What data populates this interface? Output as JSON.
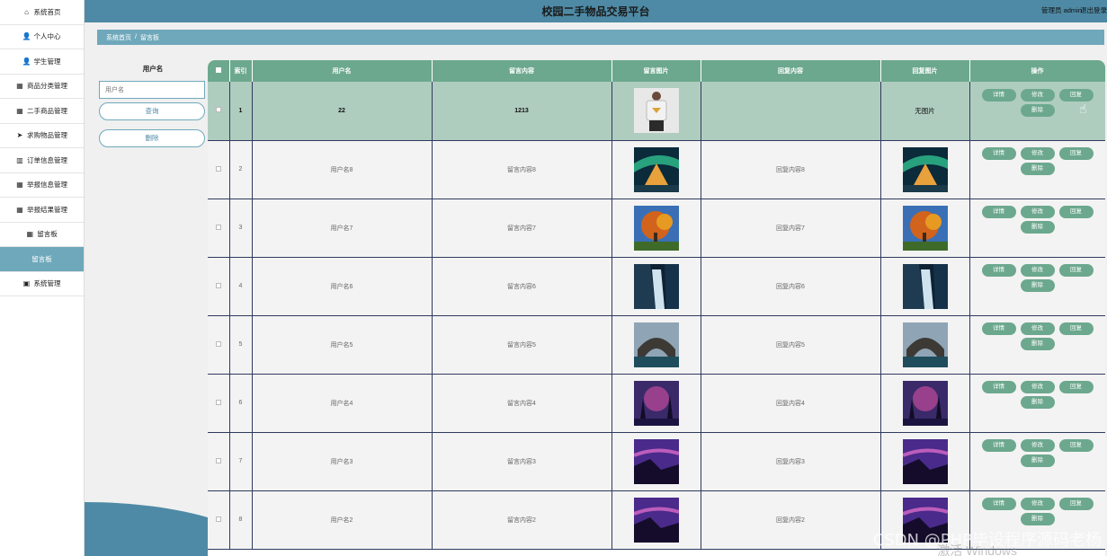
{
  "app": {
    "title": "校园二手物品交易平台",
    "user": "管理员 admin",
    "logout": "退出登录"
  },
  "sidebar": {
    "items": [
      {
        "label": "系统首页",
        "icon": "home-icon",
        "glyph": "⌂"
      },
      {
        "label": "个人中心",
        "icon": "user-icon",
        "glyph": "👤"
      },
      {
        "label": "学生管理",
        "icon": "user-icon",
        "glyph": "👤"
      },
      {
        "label": "商品分类管理",
        "icon": "grid-icon",
        "glyph": "▦"
      },
      {
        "label": "二手商品管理",
        "icon": "grid-icon",
        "glyph": "▦"
      },
      {
        "label": "求购物品管理",
        "icon": "send-icon",
        "glyph": "➤"
      },
      {
        "label": "订单信息管理",
        "icon": "chart-icon",
        "glyph": "▥"
      },
      {
        "label": "举报信息管理",
        "icon": "grid-icon",
        "glyph": "▦"
      },
      {
        "label": "举报结果管理",
        "icon": "grid-icon",
        "glyph": "▦"
      },
      {
        "label": "留言板",
        "icon": "grid-icon",
        "glyph": "▦"
      },
      {
        "label": "留言板",
        "icon": "",
        "glyph": ""
      },
      {
        "label": "系统管理",
        "icon": "settings-icon",
        "glyph": "▣"
      }
    ]
  },
  "breadcrumb": {
    "home": "系统首页",
    "sep": "/",
    "current": "留言板"
  },
  "search": {
    "label": "用户名",
    "placeholder": "用户名",
    "query_label": "查询",
    "delete_label": "删除"
  },
  "table": {
    "headers": [
      "",
      "索引",
      "用户名",
      "留言内容",
      "留言图片",
      "回复内容",
      "回复图片",
      "操作"
    ],
    "op_labels": {
      "detail": "详情",
      "edit": "修改",
      "reply": "回复",
      "delete": "删除"
    },
    "no_image": "无图片",
    "rows": [
      {
        "index": "1",
        "user": "22",
        "content": "1213",
        "reply": "",
        "msg_img": "tshirt",
        "reply_img": "none"
      },
      {
        "index": "2",
        "user": "用户名8",
        "content": "留言内容8",
        "reply": "回复内容8",
        "msg_img": "aurora-cabin",
        "reply_img": "aurora-cabin"
      },
      {
        "index": "3",
        "user": "用户名7",
        "content": "留言内容7",
        "reply": "回复内容7",
        "msg_img": "autumn-tree",
        "reply_img": "autumn-tree"
      },
      {
        "index": "4",
        "user": "用户名6",
        "content": "留言内容6",
        "reply": "回复内容6",
        "msg_img": "waterfall",
        "reply_img": "waterfall"
      },
      {
        "index": "5",
        "user": "用户名5",
        "content": "留言内容5",
        "reply": "回复内容5",
        "msg_img": "sea-arch",
        "reply_img": "sea-arch"
      },
      {
        "index": "6",
        "user": "用户名4",
        "content": "留言内容4",
        "reply": "回复内容4",
        "msg_img": "purple-forest",
        "reply_img": "purple-forest"
      },
      {
        "index": "7",
        "user": "用户名3",
        "content": "留言内容3",
        "reply": "回复内容3",
        "msg_img": "purple-coast",
        "reply_img": "purple-coast"
      },
      {
        "index": "8",
        "user": "用户名2",
        "content": "留言内容2",
        "reply": "回复内容2",
        "msg_img": "purple-coast",
        "reply_img": "purple-coast"
      }
    ]
  },
  "watermark": {
    "csdn": "CSDN @PHP毕设程序源码老杨",
    "windows": "激活 Windows"
  },
  "colors": {
    "header": "#4e8aa5",
    "accent": "#6fa8bb",
    "table_header": "#6ca88e",
    "selected_row": "#afcdbf"
  }
}
